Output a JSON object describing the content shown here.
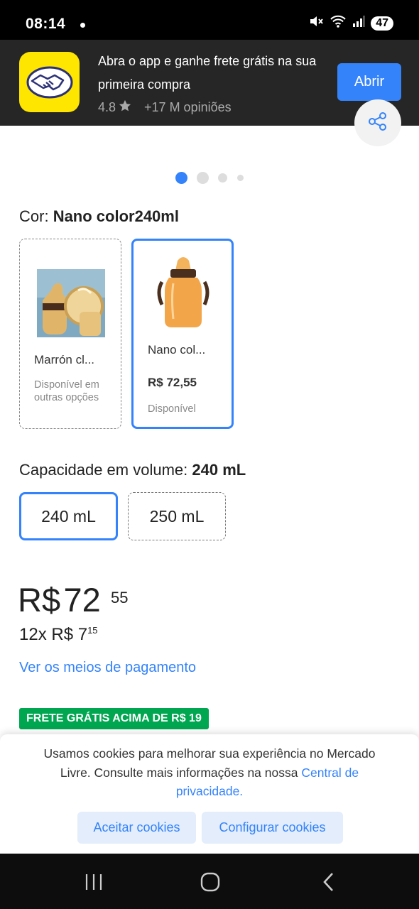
{
  "status_bar": {
    "time": "08:14",
    "battery": "47"
  },
  "app_banner": {
    "title": "Abra o app e ganhe frete grátis na sua primeira compra",
    "rating": "4.8",
    "reviews": "+17 M opiniões",
    "open_label": "Abrir"
  },
  "colors": {
    "accent": "#3483fa",
    "free_shipping": "#00a650",
    "brand_yellow": "#ffe600"
  },
  "color_section": {
    "label": "Cor:",
    "selected": "Nano color240ml",
    "options": [
      {
        "name": "Marrón cl...",
        "status": "Disponível em outras opções"
      },
      {
        "name": "Nano col...",
        "price": "R$ 72,55",
        "status": "Disponível"
      }
    ]
  },
  "capacity_section": {
    "label": "Capacidade em volume:",
    "selected": "240 mL",
    "options": [
      "240 mL",
      "250 mL"
    ]
  },
  "price": {
    "currency": "R$",
    "integer": "72",
    "cents": "55",
    "installments_prefix": "12x R$ 7",
    "installments_cents": "15",
    "payment_link": "Ver os meios de pagamento"
  },
  "free_shipping": "FRETE GRÁTIS ACIMA DE R$ 19",
  "cookie_banner": {
    "text": "Usamos cookies para melhorar sua experiência no Mercado Livre. Consulte mais informações na nossa",
    "link": "Central de privacidade.",
    "accept": "Aceitar cookies",
    "configure": "Configurar cookies"
  },
  "icons": [
    "mute-icon",
    "wifi-icon",
    "signal-icon",
    "star-icon",
    "share-icon",
    "recent-apps-icon",
    "home-icon",
    "back-icon"
  ]
}
